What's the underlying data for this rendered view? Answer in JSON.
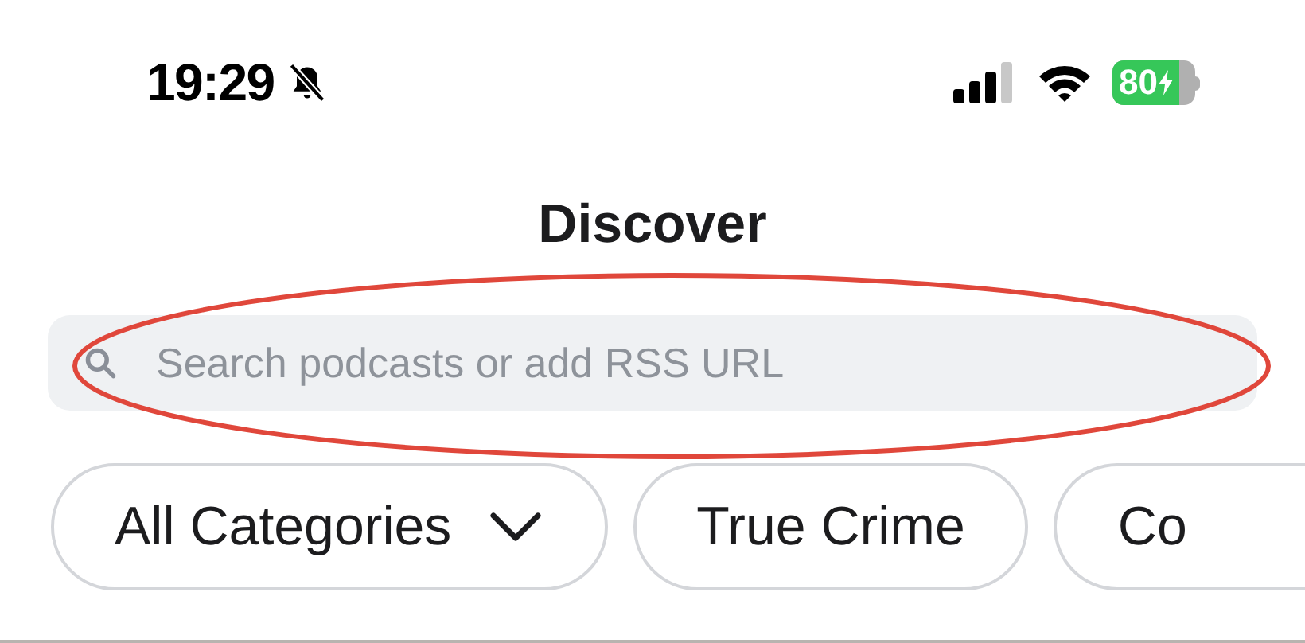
{
  "status_bar": {
    "time": "19:29",
    "silent": true,
    "battery": "80"
  },
  "title": "Discover",
  "search": {
    "placeholder": "Search podcasts or add RSS URL"
  },
  "categories": [
    {
      "label": "All Categories",
      "kind": "dropdown"
    },
    {
      "label": "True Crime",
      "kind": "chip"
    },
    {
      "label": "Co",
      "kind": "chip"
    }
  ]
}
